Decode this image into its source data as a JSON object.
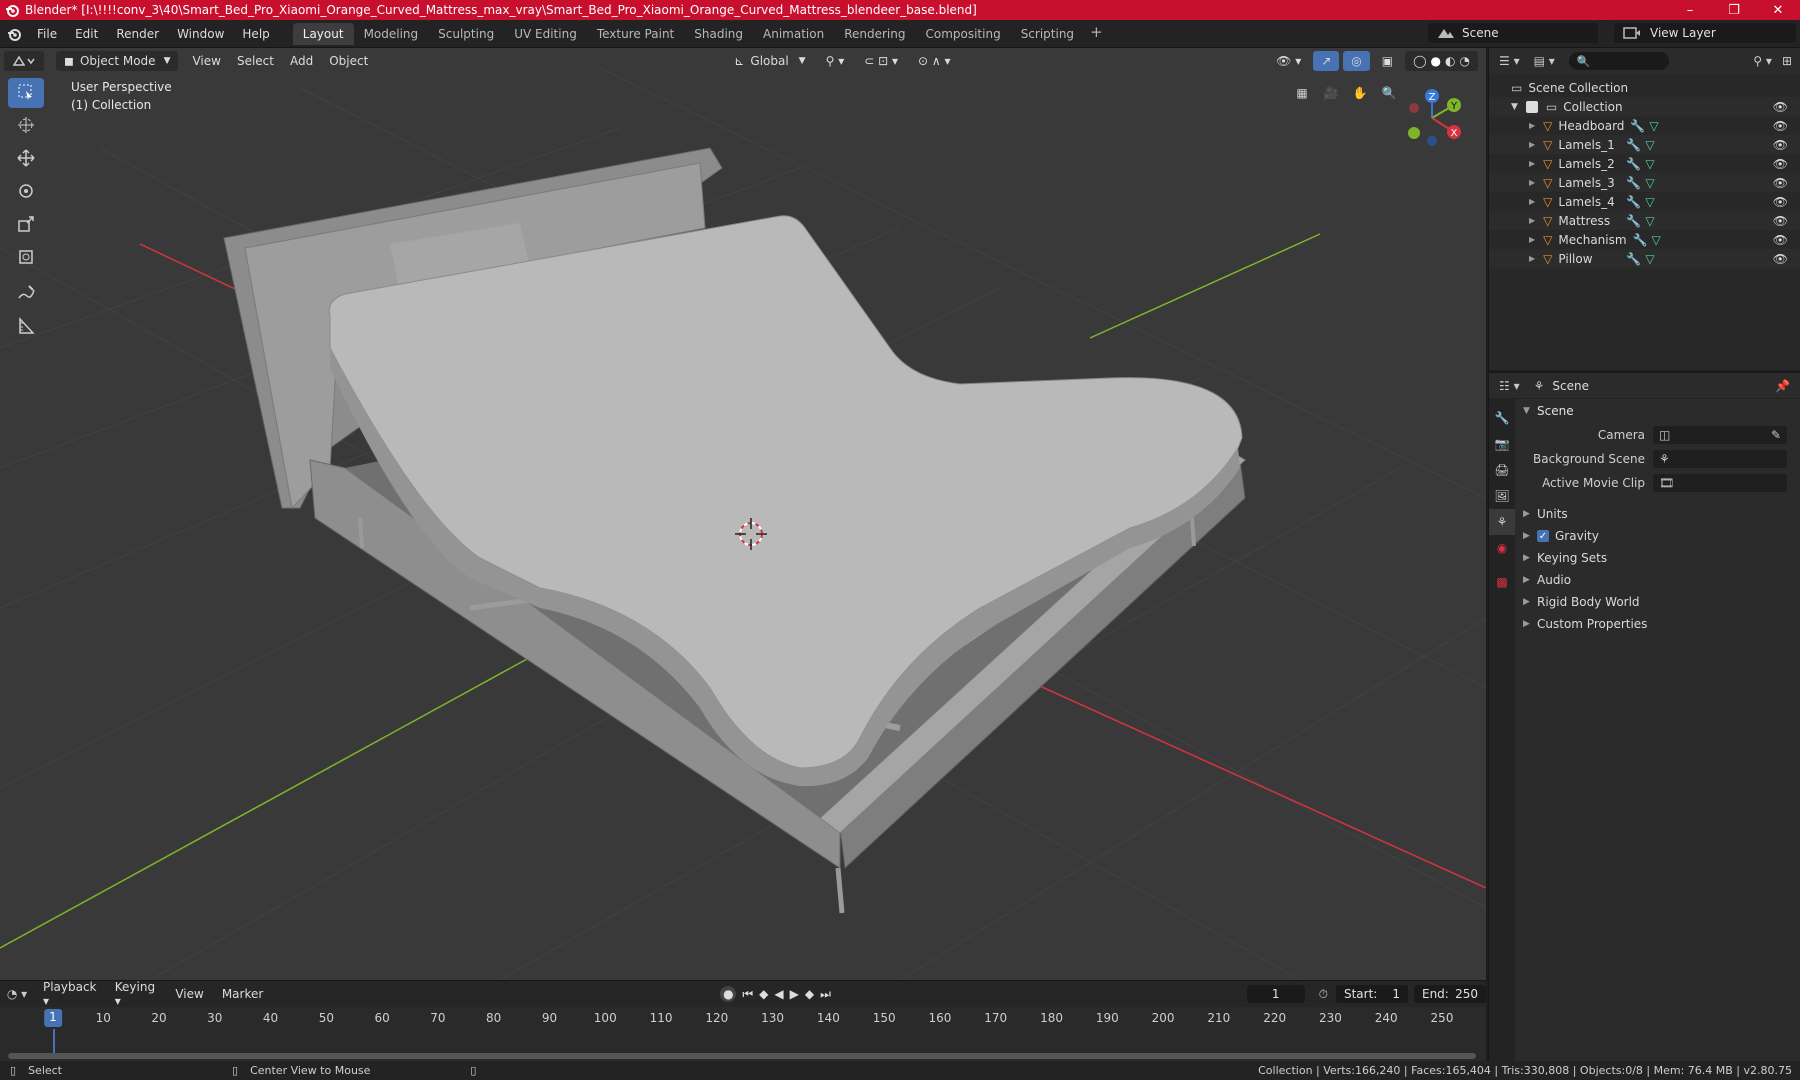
{
  "window": {
    "title": "Blender* [I:\\!!!!conv_3\\40\\Smart_Bed_Pro_Xiaomi_Orange_Curved_Mattress_max_vray\\Smart_Bed_Pro_Xiaomi_Orange_Curved_Mattress_blendeer_base.blend]",
    "controls": [
      "–",
      "❐",
      "✕"
    ]
  },
  "menubar": {
    "items": [
      "File",
      "Edit",
      "Render",
      "Window",
      "Help"
    ],
    "workspaces": [
      "Layout",
      "Modeling",
      "Sculpting",
      "UV Editing",
      "Texture Paint",
      "Shading",
      "Animation",
      "Rendering",
      "Compositing",
      "Scripting"
    ],
    "active_workspace": "Layout",
    "add_tab": "+",
    "scene": "Scene",
    "view_layer": "View Layer"
  },
  "viewport": {
    "mode": "Object Mode",
    "menus": [
      "View",
      "Select",
      "Add",
      "Object"
    ],
    "orientation": "Global",
    "perspective_label": "User Perspective",
    "collection_label": "(1) Collection",
    "gizmo_axes": {
      "z": "Z",
      "y": "Y",
      "x": "X"
    },
    "tools": [
      "select-box",
      "cursor",
      "move",
      "rotate",
      "scale",
      "transform",
      "annotate",
      "measure"
    ]
  },
  "timeline": {
    "menus": [
      "Playback",
      "Keying",
      "View",
      "Marker"
    ],
    "current_frame": "1",
    "start_label": "Start:",
    "start": "1",
    "end_label": "End:",
    "end": "250",
    "ticks": [
      "10",
      "20",
      "30",
      "40",
      "50",
      "60",
      "70",
      "80",
      "90",
      "100",
      "110",
      "120",
      "130",
      "140",
      "150",
      "160",
      "170",
      "180",
      "190",
      "200",
      "210",
      "220",
      "230",
      "240",
      "250"
    ],
    "cursor_label": "1"
  },
  "statusbar": {
    "select": "Select",
    "center_view": "Center View to Mouse",
    "stats": "Collection | Verts:166,240 | Faces:165,404 | Tris:330,808 | Objects:0/8 | Mem: 76.4 MB | v2.80.75"
  },
  "outliner": {
    "scene_collection": "Scene Collection",
    "collection": "Collection",
    "objects": [
      "Headboard",
      "Lamels_1",
      "Lamels_2",
      "Lamels_3",
      "Lamels_4",
      "Mattress",
      "Mechanism",
      "Pillow"
    ]
  },
  "properties": {
    "header_title": "Scene",
    "panel_title": "Scene",
    "camera_label": "Camera",
    "background_scene_label": "Background Scene",
    "active_movie_clip_label": "Active Movie Clip",
    "subpanels": [
      "Units",
      "Gravity",
      "Keying Sets",
      "Audio",
      "Rigid Body World",
      "Custom Properties"
    ],
    "gravity_checked": true
  },
  "colors": {
    "title_bar": "#c8102e",
    "accent": "#4772b3",
    "viewport_bg": "#393939",
    "object_orange": "#e8932a",
    "mesh_green": "#4fd0a0",
    "axis_x": "#d8323f",
    "axis_y": "#7fb52a",
    "axis_z": "#3a78d8"
  }
}
